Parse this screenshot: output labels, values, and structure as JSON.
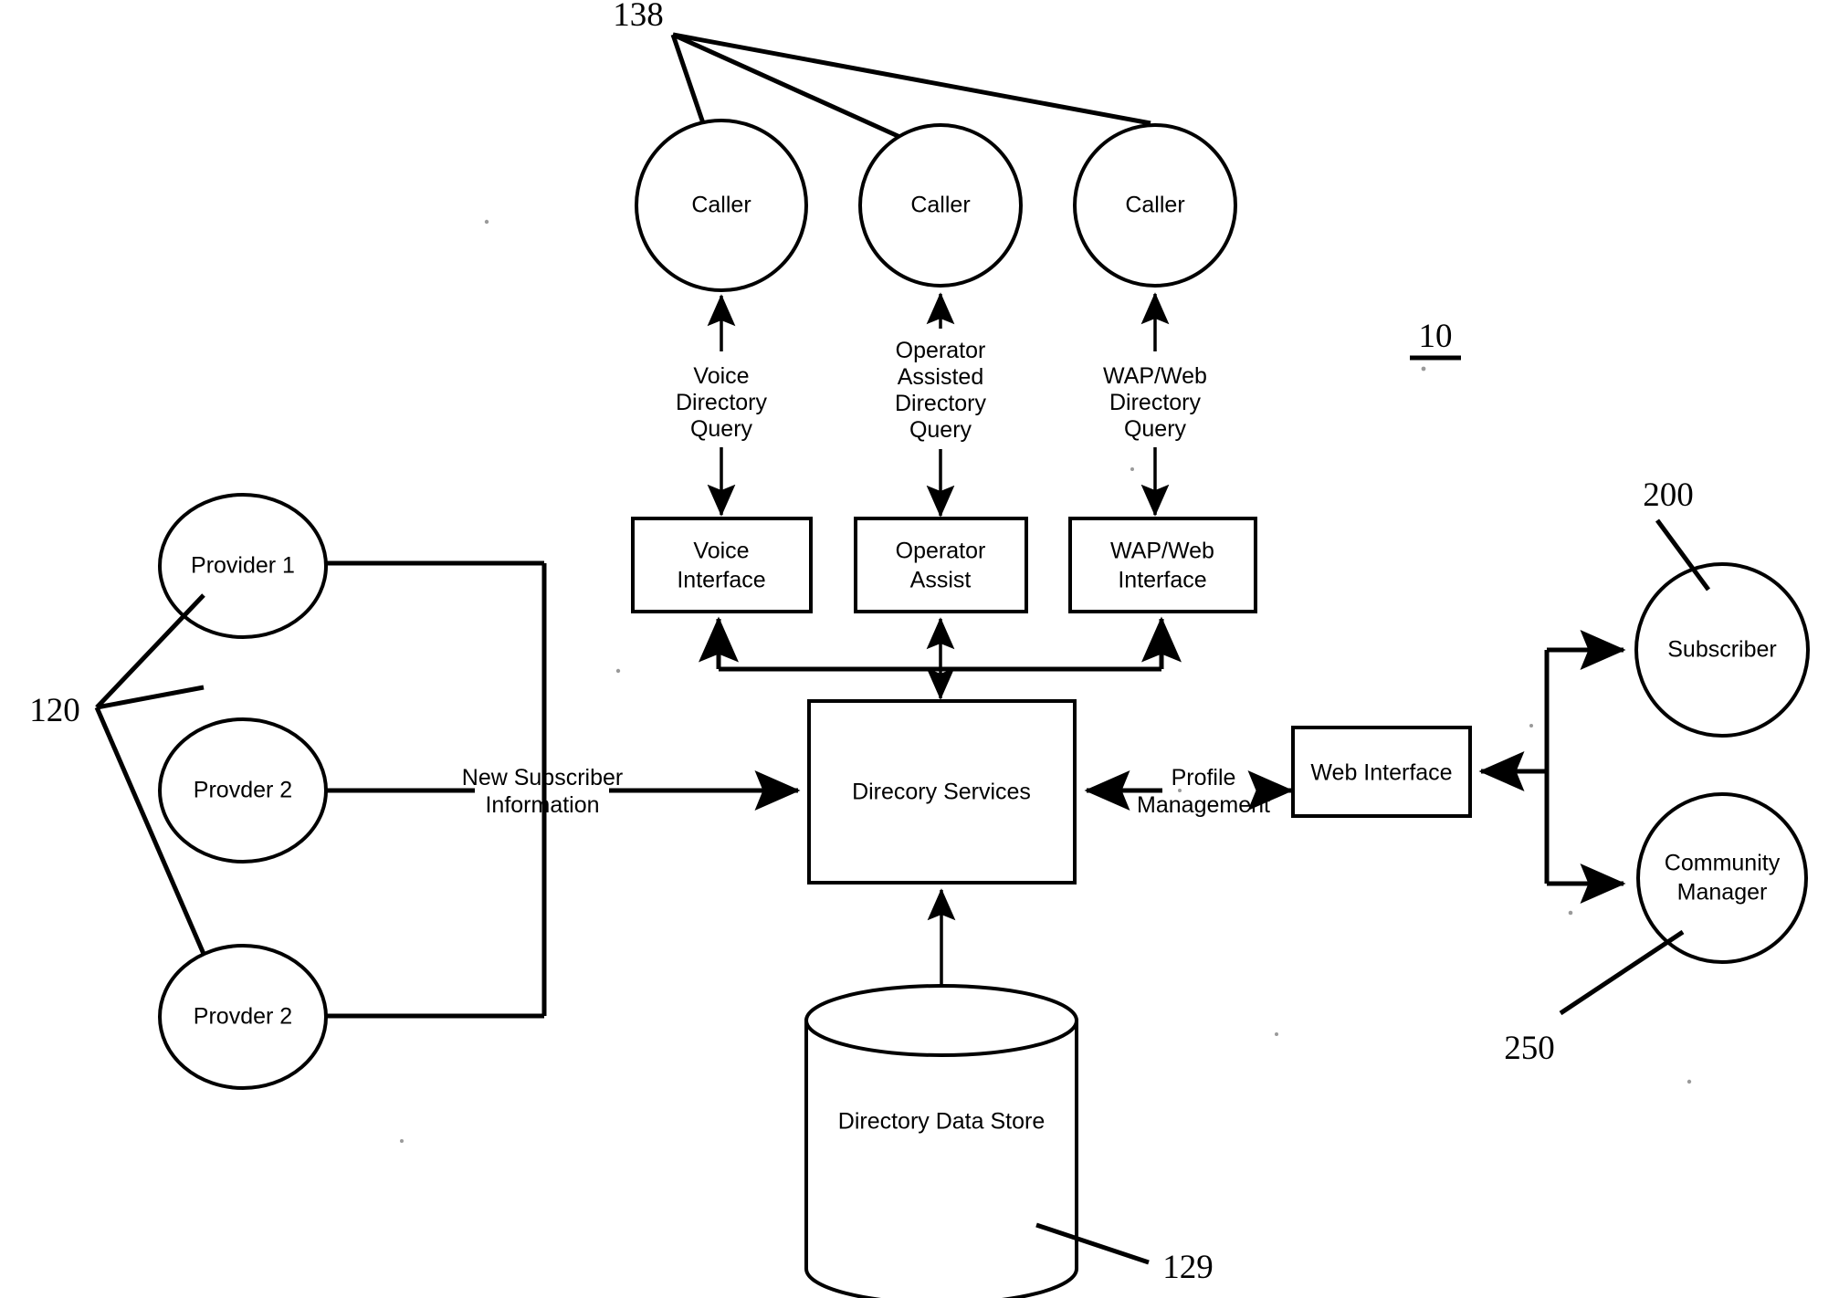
{
  "figure": {
    "overall_ref": "10",
    "callers_ref": "138",
    "providers_ref": "120",
    "datastore_ref": "129",
    "subscriber_ref": "200",
    "community_manager_ref": "250"
  },
  "callers": [
    {
      "label": "Caller"
    },
    {
      "label": "Caller"
    },
    {
      "label": "Caller"
    }
  ],
  "query_flows": [
    {
      "lines": [
        "Voice",
        "Directory",
        "Query"
      ]
    },
    {
      "lines": [
        "Operator",
        "Assisted",
        "Directory",
        "Query"
      ]
    },
    {
      "lines": [
        "WAP/Web",
        "Directory",
        "Query"
      ]
    }
  ],
  "interfaces": [
    {
      "lines": [
        "Voice",
        "Interface"
      ]
    },
    {
      "lines": [
        "Operator",
        "Assist"
      ]
    },
    {
      "lines": [
        "WAP/Web",
        "Interface"
      ]
    }
  ],
  "providers": [
    {
      "label": "Provider 1"
    },
    {
      "label": "Provder 2"
    },
    {
      "label": "Provder 2"
    }
  ],
  "core": {
    "directory_services": "Direcory Services",
    "data_store": "Directory Data Store",
    "new_subscriber_flow": [
      "New Subscriber",
      "Information"
    ],
    "profile_management_flow": [
      "Profile",
      "Management"
    ]
  },
  "right": {
    "web_interface": "Web Interface",
    "subscriber": "Subscriber",
    "community_manager": [
      "Community",
      "Manager"
    ]
  },
  "colors": {
    "ink": "#000000",
    "paper": "#ffffff"
  }
}
